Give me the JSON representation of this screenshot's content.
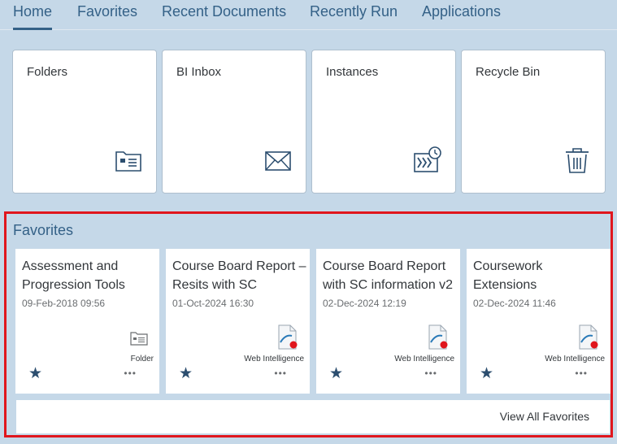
{
  "nav": {
    "tabs": [
      {
        "label": "Home",
        "active": true
      },
      {
        "label": "Favorites"
      },
      {
        "label": "Recent Documents"
      },
      {
        "label": "Recently Run"
      },
      {
        "label": "Applications"
      }
    ]
  },
  "tiles": [
    {
      "title": "Folders",
      "icon": "folder-card-icon"
    },
    {
      "title": "BI Inbox",
      "icon": "envelope-icon"
    },
    {
      "title": "Instances",
      "icon": "instances-clock-icon"
    },
    {
      "title": "Recycle Bin",
      "icon": "trash-icon"
    }
  ],
  "favorites": {
    "heading": "Favorites",
    "view_all": "View All Favorites",
    "items": [
      {
        "title": "Assessment and Progression Tools",
        "date": "09-Feb-2018 09:56",
        "type": "Folder",
        "icon": "folder-card-icon"
      },
      {
        "title": "Course Board Report – Resits with SC",
        "date": "01-Oct-2024 16:30",
        "type": "Web Intelligence",
        "icon": "webi-document-icon"
      },
      {
        "title": "Course Board Report with SC information v2",
        "date": "02-Dec-2024 12:19",
        "type": "Web Intelligence",
        "icon": "webi-document-icon"
      },
      {
        "title": "Coursework Extensions",
        "date": "02-Dec-2024 11:46",
        "type": "Web Intelligence",
        "icon": "webi-document-icon"
      }
    ],
    "star_glyph": "★",
    "more_glyph": "•••"
  },
  "colors": {
    "background": "#c5d8e8",
    "nav_text": "#346187",
    "highlight_border": "#e0161d",
    "star": "#2c4e6f",
    "webi_dot": "#e0161d"
  }
}
